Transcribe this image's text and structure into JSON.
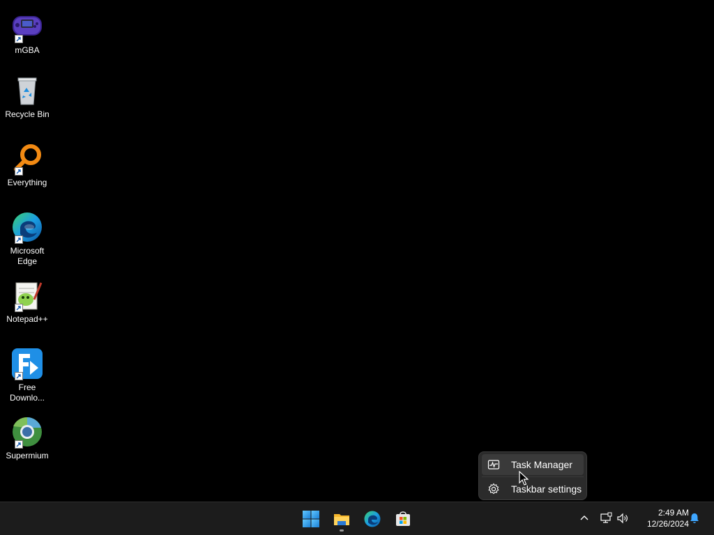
{
  "desktop": {
    "icons": [
      {
        "label": "mGBA",
        "icon": "gameboy-advance-icon",
        "shortcut": true
      },
      {
        "label": "Recycle Bin",
        "icon": "recycle-bin-icon",
        "shortcut": false
      },
      {
        "label": "Everything",
        "icon": "magnifier-ring-icon",
        "shortcut": true
      },
      {
        "label": "Microsoft Edge",
        "icon": "edge-icon",
        "shortcut": true
      },
      {
        "label": "Notepad++",
        "icon": "notepad-plus-plus-icon",
        "shortcut": true
      },
      {
        "label": "Free Downlo...",
        "icon": "download-arrow-icon",
        "shortcut": true
      },
      {
        "label": "Supermium",
        "icon": "chromium-globe-icon",
        "shortcut": true
      }
    ]
  },
  "context_menu": {
    "items": [
      {
        "label": "Task Manager",
        "icon": "activity-chart-icon"
      },
      {
        "label": "Taskbar settings",
        "icon": "gear-icon"
      }
    ]
  },
  "taskbar": {
    "apps": [
      {
        "name": "Start",
        "icon": "windows-logo-icon"
      },
      {
        "name": "File Explorer",
        "icon": "folder-icon",
        "running": true
      },
      {
        "name": "Microsoft Edge",
        "icon": "edge-icon"
      },
      {
        "name": "Microsoft Store",
        "icon": "store-bag-icon"
      }
    ],
    "tray": {
      "icons": [
        "chevron-up-icon",
        "network-icon",
        "speaker-icon",
        "notification-bell-icon"
      ],
      "time": "2:49 AM",
      "date": "12/26/2024"
    }
  },
  "colors": {
    "desktop_bg": "#000000",
    "taskbar_bg": "#1c1c1c",
    "menu_bg": "#2b2b2b",
    "accent": "#0078d4"
  }
}
